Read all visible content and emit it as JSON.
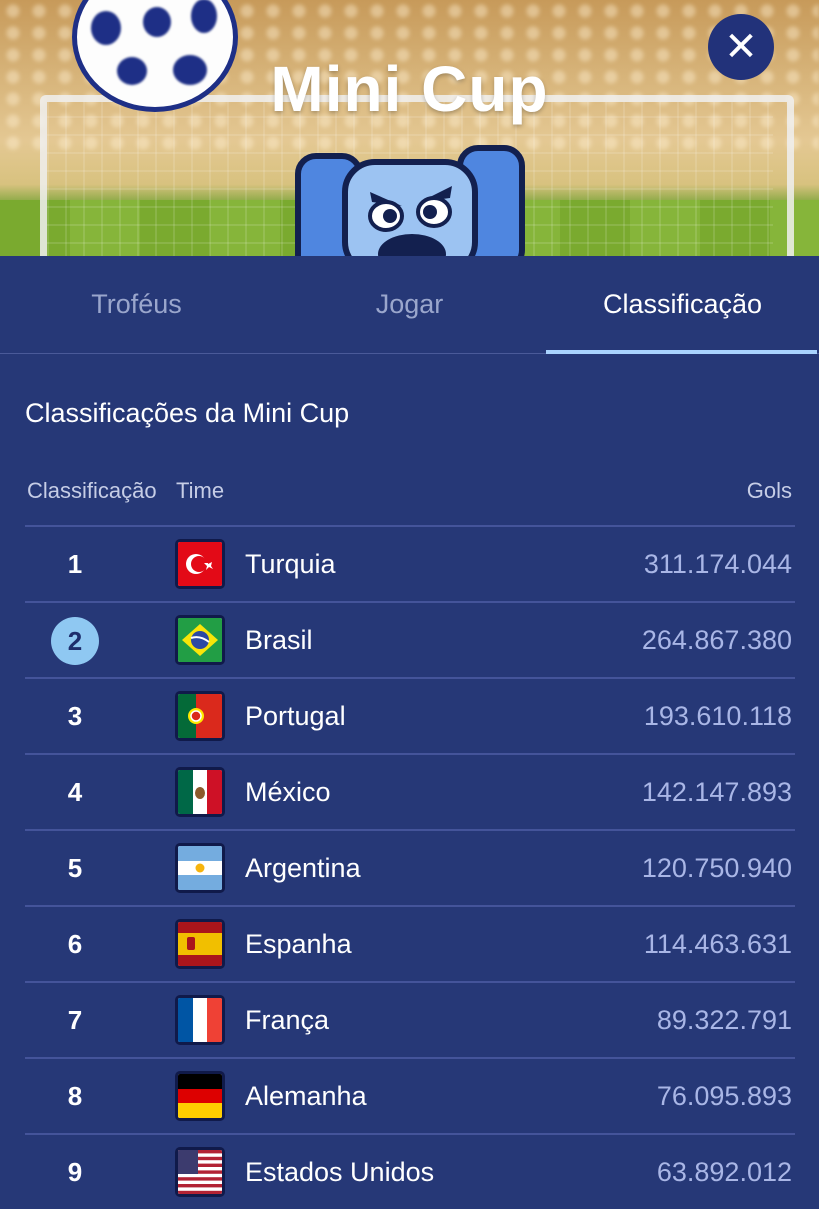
{
  "header": {
    "title": "Mini Cup",
    "close_icon": "close-icon"
  },
  "tabs": [
    {
      "label": "Troféus",
      "active": false
    },
    {
      "label": "Jogar",
      "active": false
    },
    {
      "label": "Classificação",
      "active": true
    }
  ],
  "section_title": "Classificações da Mini Cup",
  "columns": {
    "rank": "Classificação",
    "team": "Time",
    "goals": "Gols"
  },
  "rows": [
    {
      "rank": "1",
      "team": "Turquia",
      "goals": "311.174.044",
      "flag": "turkey-flag-icon"
    },
    {
      "rank": "2",
      "team": "Brasil",
      "goals": "264.867.380",
      "flag": "brazil-flag-icon",
      "highlight": true
    },
    {
      "rank": "3",
      "team": "Portugal",
      "goals": "193.610.118",
      "flag": "portugal-flag-icon"
    },
    {
      "rank": "4",
      "team": "México",
      "goals": "142.147.893",
      "flag": "mexico-flag-icon"
    },
    {
      "rank": "5",
      "team": "Argentina",
      "goals": "120.750.940",
      "flag": "argentina-flag-icon"
    },
    {
      "rank": "6",
      "team": "Espanha",
      "goals": "114.463.631",
      "flag": "spain-flag-icon"
    },
    {
      "rank": "7",
      "team": "França",
      "goals": "89.322.791",
      "flag": "france-flag-icon"
    },
    {
      "rank": "8",
      "team": "Alemanha",
      "goals": "76.095.893",
      "flag": "germany-flag-icon"
    },
    {
      "rank": "9",
      "team": "Estados Unidos",
      "goals": "63.892.012",
      "flag": "usa-flag-icon"
    }
  ],
  "colors": {
    "background": "#263877",
    "highlight_rank": "#8fc8f2",
    "active_tab_underline": "#a9d3ff",
    "goals_text": "#a9b6e6"
  }
}
